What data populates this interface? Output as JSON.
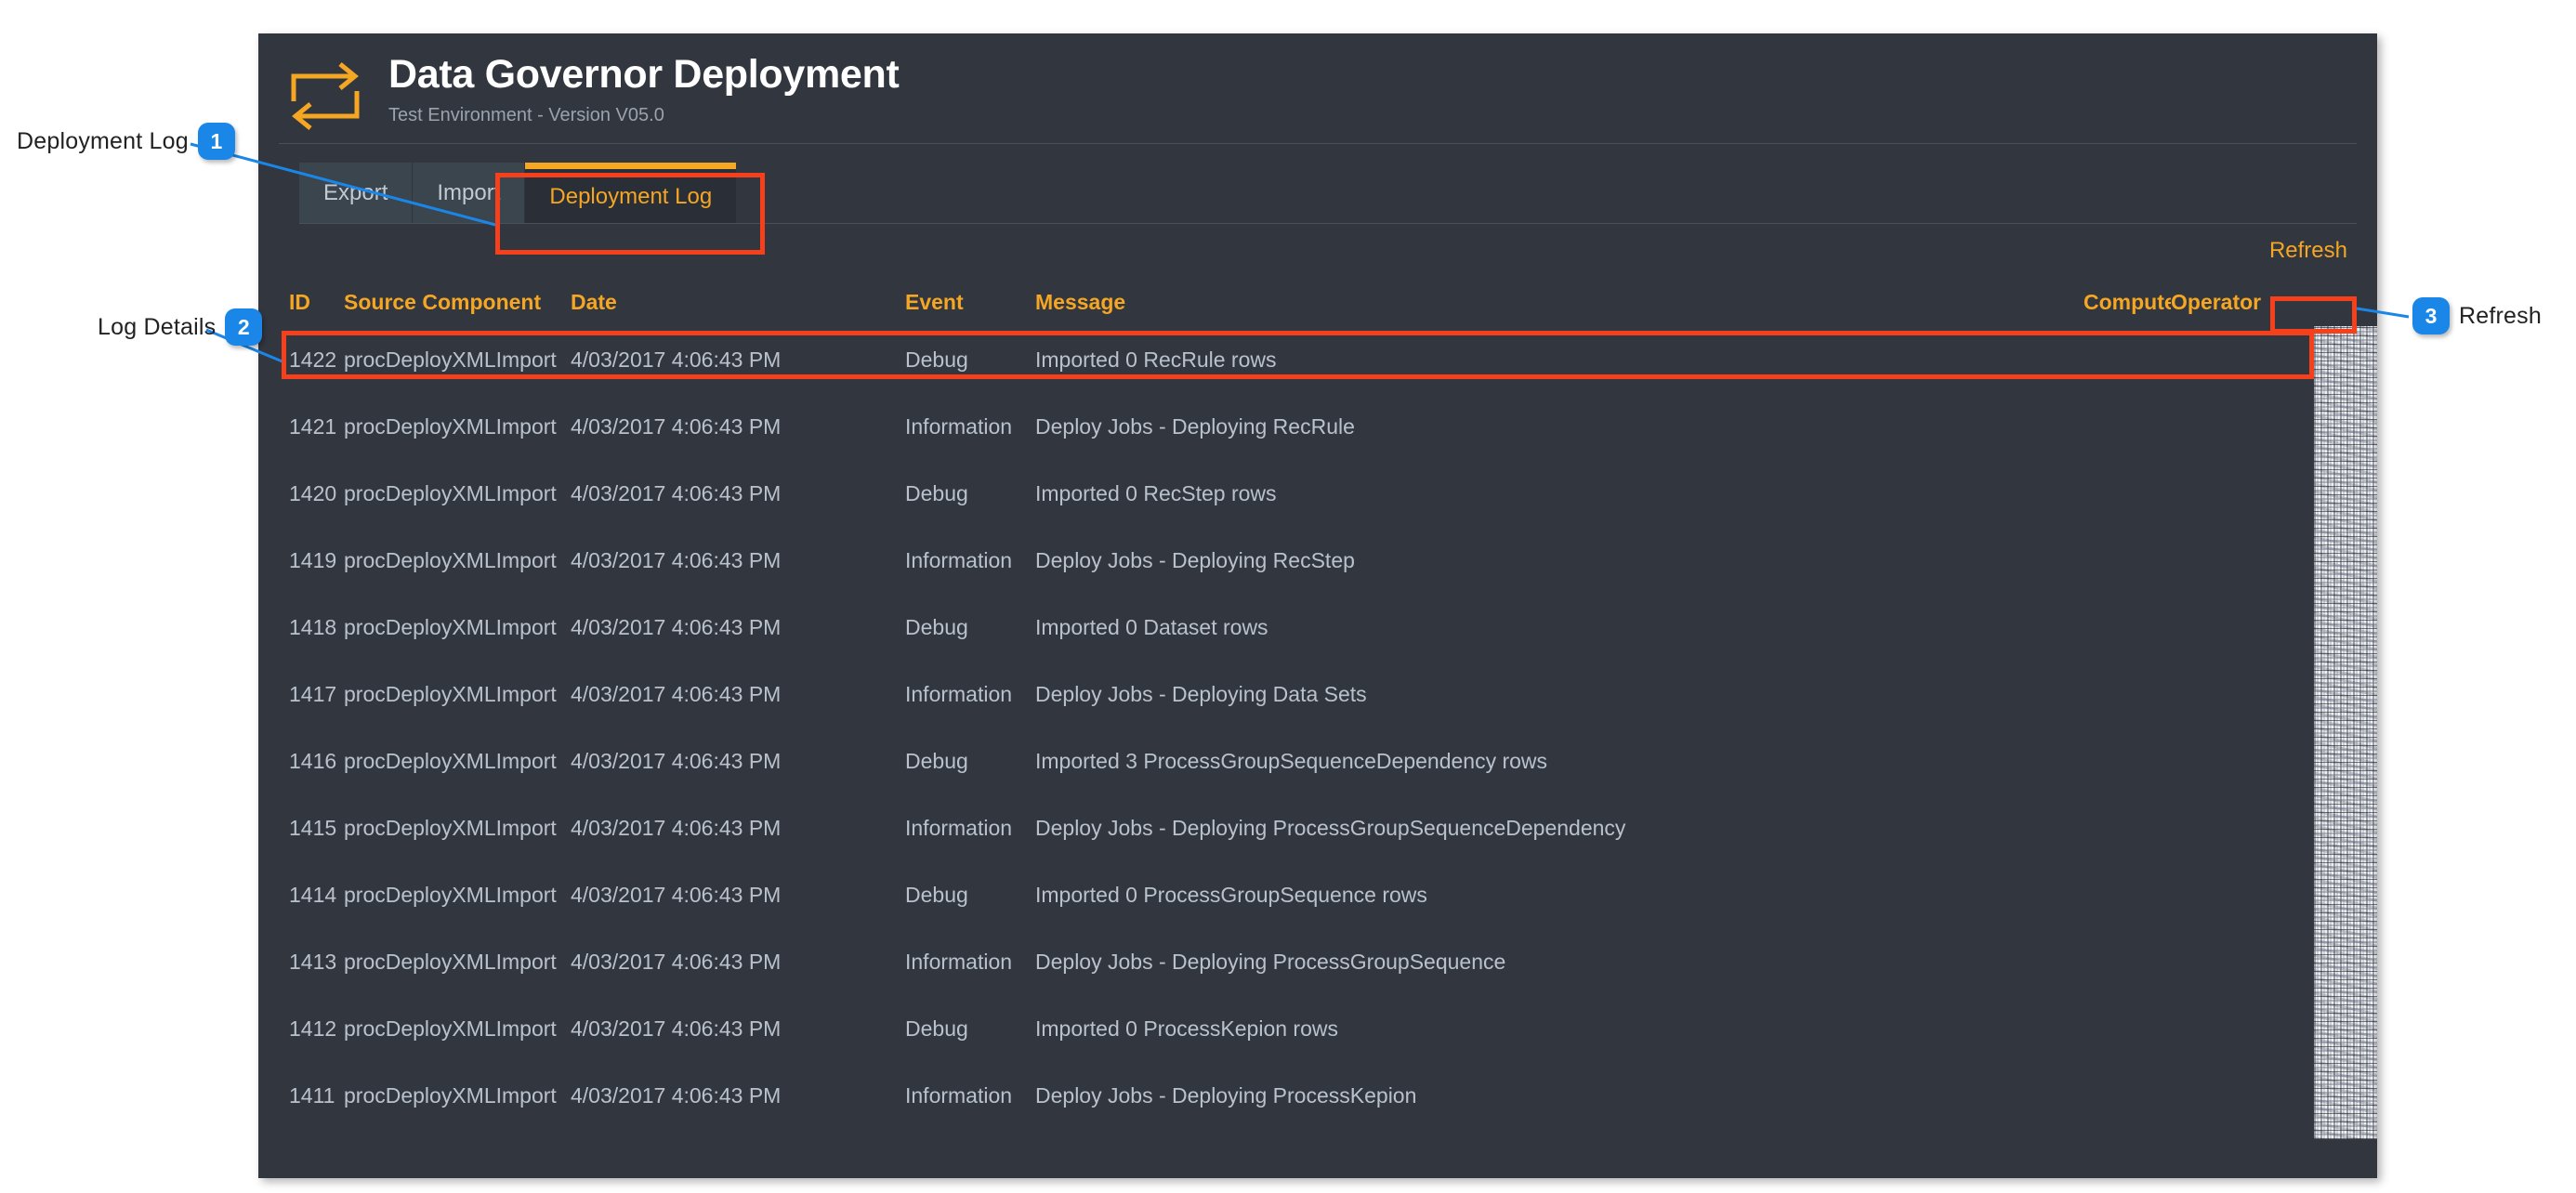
{
  "app": {
    "logo_icon": "repeat-arrows-icon",
    "title": "Data Governor Deployment",
    "subtitle": "Test Environment - Version V05.0",
    "accent_color": "#f5a623",
    "panel_bg": "#32363f",
    "highlight_color": "#f5401b",
    "callout_color": "#1a86e8"
  },
  "tabs": [
    {
      "label": "Export",
      "active": false
    },
    {
      "label": "Import",
      "active": false
    },
    {
      "label": "Deployment Log",
      "active": true
    }
  ],
  "toolbar": {
    "refresh_label": "Refresh"
  },
  "table": {
    "columns": [
      "ID",
      "Source Component",
      "Date",
      "Event",
      "Message",
      "Computer",
      "Operator"
    ],
    "rows": [
      {
        "id": "1422",
        "source": "procDeployXMLImport",
        "date": "4/03/2017 4:06:43 PM",
        "event": "Debug",
        "message": "Imported 0 RecRule rows"
      },
      {
        "id": "1421",
        "source": "procDeployXMLImport",
        "date": "4/03/2017 4:06:43 PM",
        "event": "Information",
        "message": "Deploy Jobs - Deploying RecRule"
      },
      {
        "id": "1420",
        "source": "procDeployXMLImport",
        "date": "4/03/2017 4:06:43 PM",
        "event": "Debug",
        "message": "Imported 0 RecStep rows"
      },
      {
        "id": "1419",
        "source": "procDeployXMLImport",
        "date": "4/03/2017 4:06:43 PM",
        "event": "Information",
        "message": "Deploy Jobs - Deploying RecStep"
      },
      {
        "id": "1418",
        "source": "procDeployXMLImport",
        "date": "4/03/2017 4:06:43 PM",
        "event": "Debug",
        "message": "Imported 0 Dataset rows"
      },
      {
        "id": "1417",
        "source": "procDeployXMLImport",
        "date": "4/03/2017 4:06:43 PM",
        "event": "Information",
        "message": "Deploy Jobs - Deploying Data Sets"
      },
      {
        "id": "1416",
        "source": "procDeployXMLImport",
        "date": "4/03/2017 4:06:43 PM",
        "event": "Debug",
        "message": "Imported 3 ProcessGroupSequenceDependency rows"
      },
      {
        "id": "1415",
        "source": "procDeployXMLImport",
        "date": "4/03/2017 4:06:43 PM",
        "event": "Information",
        "message": "Deploy Jobs - Deploying ProcessGroupSequenceDependency"
      },
      {
        "id": "1414",
        "source": "procDeployXMLImport",
        "date": "4/03/2017 4:06:43 PM",
        "event": "Debug",
        "message": "Imported 0 ProcessGroupSequence rows"
      },
      {
        "id": "1413",
        "source": "procDeployXMLImport",
        "date": "4/03/2017 4:06:43 PM",
        "event": "Information",
        "message": "Deploy Jobs - Deploying ProcessGroupSequence"
      },
      {
        "id": "1412",
        "source": "procDeployXMLImport",
        "date": "4/03/2017 4:06:43 PM",
        "event": "Debug",
        "message": "Imported 0 ProcessKepion rows"
      },
      {
        "id": "1411",
        "source": "procDeployXMLImport",
        "date": "4/03/2017 4:06:43 PM",
        "event": "Information",
        "message": "Deploy Jobs - Deploying ProcessKepion"
      }
    ]
  },
  "annotations": [
    {
      "number": "1",
      "label": "Deployment Log"
    },
    {
      "number": "2",
      "label": "Log Details"
    },
    {
      "number": "3",
      "label": "Refresh"
    }
  ]
}
